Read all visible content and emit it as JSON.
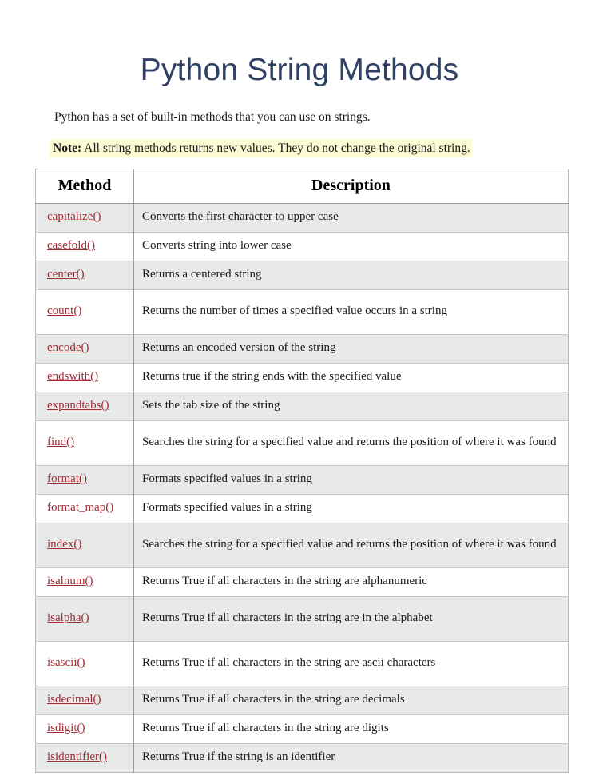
{
  "document": {
    "title": "Python String Methods",
    "intro": "Python has a set of built-in methods that you can use on strings.",
    "note_label": "Note:",
    "note_text": " All string methods returns new values. They do not change the original string.",
    "colors": {
      "title": "#2f4165",
      "link": "#a02c34",
      "highlight": "#fdfbd4",
      "row_shade": "#e8e9e9",
      "row_plain": "#ffffff",
      "border": "#9a9a9a"
    }
  },
  "table": {
    "headers": [
      "Method",
      "Description"
    ],
    "rows": [
      {
        "method": "capitalize()",
        "link": true,
        "description": "Converts the first character to upper case"
      },
      {
        "method": "casefold()",
        "link": true,
        "description": "Converts string into lower case"
      },
      {
        "method": "center()",
        "link": true,
        "description": "Returns a centered string"
      },
      {
        "method": "count()",
        "link": true,
        "description": "Returns the number of times a specified value occurs in a string"
      },
      {
        "method": "encode()",
        "link": true,
        "description": "Returns an encoded version of the string"
      },
      {
        "method": "endswith()",
        "link": true,
        "description": "Returns true if the string ends with the specified value"
      },
      {
        "method": "expandtabs()",
        "link": true,
        "description": "Sets the tab size of the string"
      },
      {
        "method": "find()",
        "link": true,
        "description": "Searches the string for a specified value and returns the position of where it was found"
      },
      {
        "method": "format()",
        "link": true,
        "description": "Formats specified values in a string"
      },
      {
        "method": "format_map()",
        "link": false,
        "description": "Formats specified values in a string"
      },
      {
        "method": "index()",
        "link": true,
        "description": "Searches the string for a specified value and returns the position of where it was found"
      },
      {
        "method": "isalnum()",
        "link": true,
        "description": "Returns True if all characters in the string are alphanumeric"
      },
      {
        "method": "isalpha()",
        "link": true,
        "description": "Returns True if all characters in the string are in the alphabet"
      },
      {
        "method": "isascii()",
        "link": true,
        "description": "Returns True if all characters in the string are ascii characters"
      },
      {
        "method": "isdecimal()",
        "link": true,
        "description": "Returns True if all characters in the string are decimals"
      },
      {
        "method": "isdigit()",
        "link": true,
        "description": "Returns True if all characters in the string are digits"
      },
      {
        "method": "isidentifier()",
        "link": true,
        "description": "Returns True if the string is an identifier"
      }
    ]
  }
}
